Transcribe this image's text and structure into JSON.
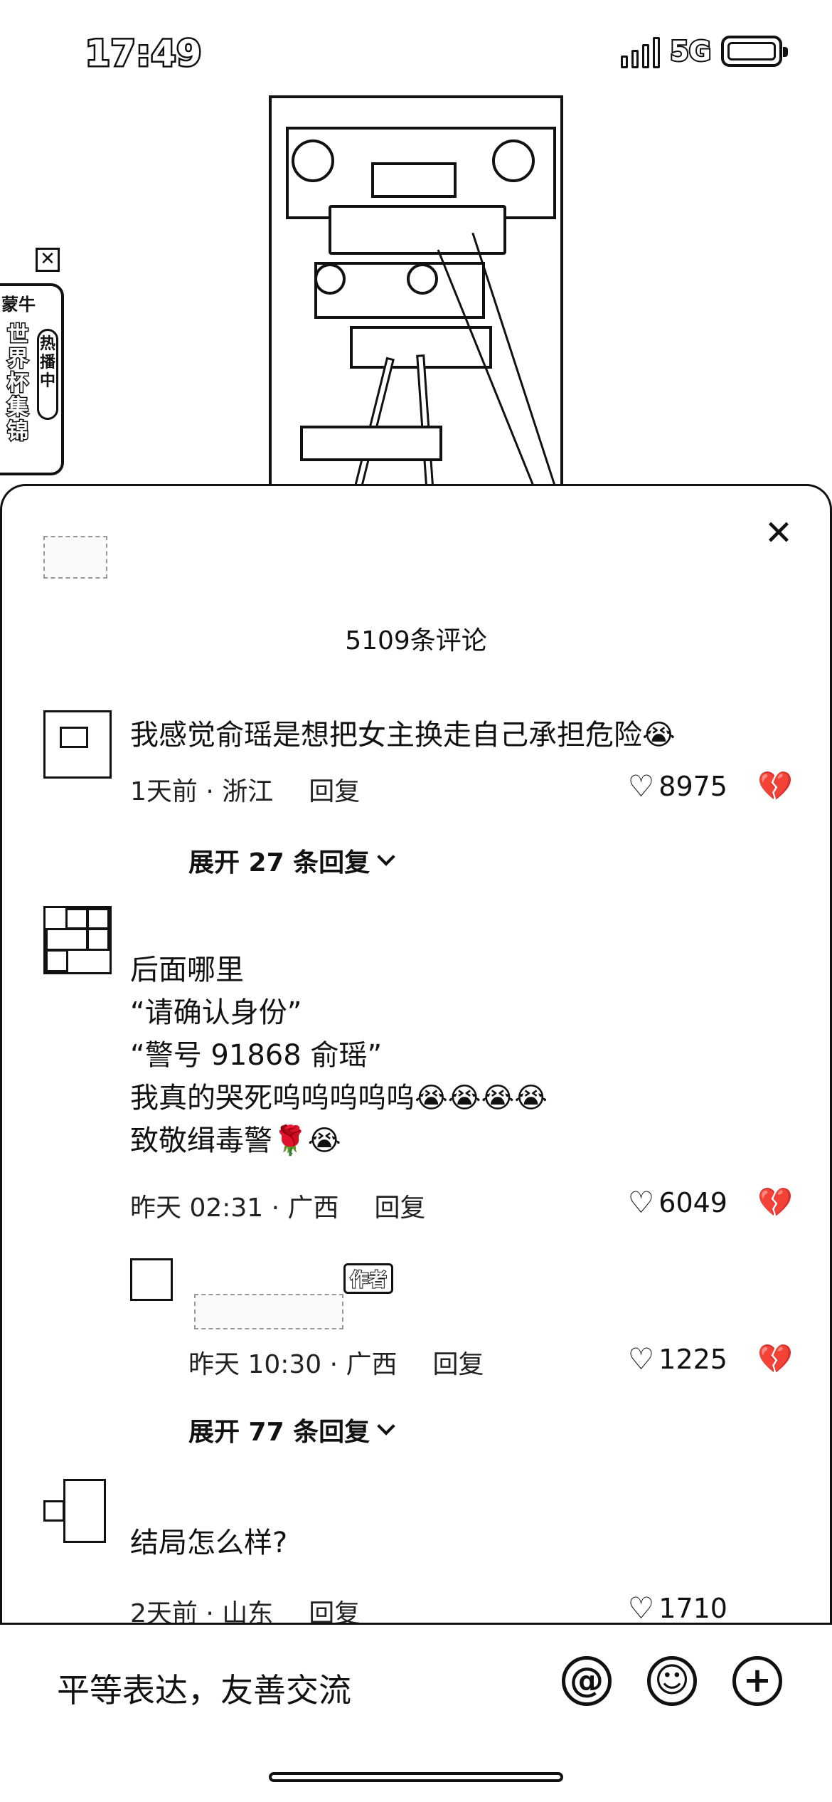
{
  "status_bar": {
    "time": "17:49",
    "network": "5G"
  },
  "ad": {
    "brand": "蒙牛",
    "title": "世界杯集锦",
    "badge": "热播中",
    "close": "✕"
  },
  "sheet": {
    "title": "5109条评论",
    "close": "✕"
  },
  "comments": [
    {
      "text": "我感觉俞瑶是想把女主换走自己承担危险😭",
      "meta": "1天前 · 浙江",
      "reply": "回复",
      "likes": "8975",
      "expand": "展开 27 条回复"
    },
    {
      "text": "后面哪里\n“请确认身份”\n“警号 91868  俞瑶”\n我真的哭死呜呜呜呜呜😭😭😭😭\n致敬缉毒警🌹😭",
      "meta": "昨天 02:31 · 广西",
      "reply": "回复",
      "likes": "6049",
      "sub_reply": {
        "tag": "作者",
        "meta": "昨天 10:30 · 广西",
        "reply": "回复",
        "likes": "1225"
      },
      "expand": "展开 77 条回复"
    },
    {
      "text": "结局怎么样?",
      "meta": "2天前 · 山东",
      "reply": "回复",
      "likes": "1710"
    }
  ],
  "input": {
    "placeholder": "平等表达，友善交流",
    "icons": [
      "at-icon",
      "emoji-icon",
      "plus-icon"
    ]
  }
}
